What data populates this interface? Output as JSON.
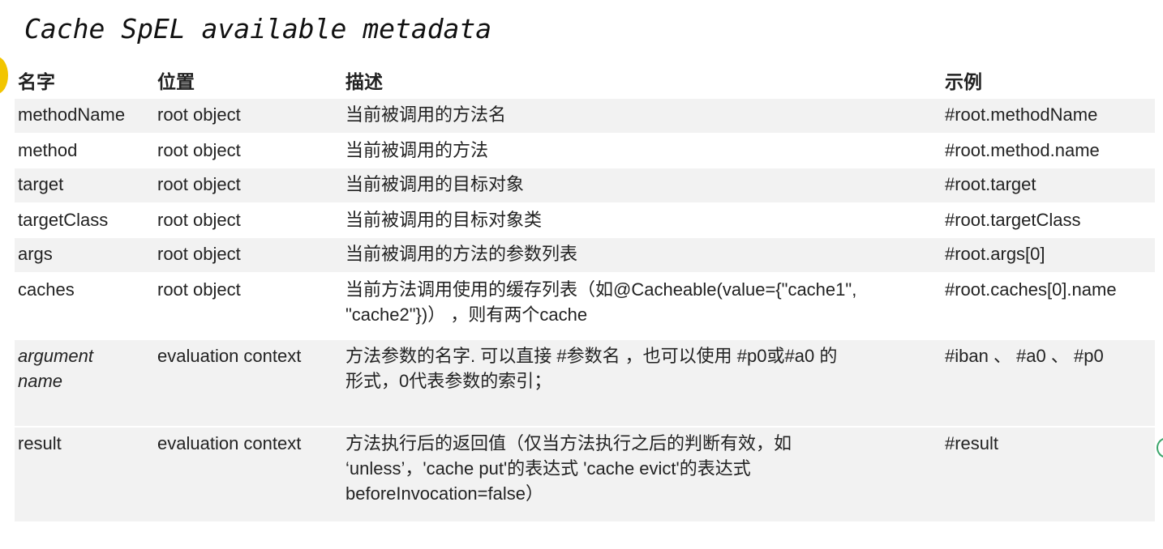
{
  "title": "Cache SpEL available metadata",
  "headers": {
    "name": "名字",
    "location": "位置",
    "description": "描述",
    "example": "示例"
  },
  "rows": [
    {
      "name": "methodName",
      "location": "root object",
      "description": "当前被调用的方法名",
      "example": "#root.methodName"
    },
    {
      "name": "method",
      "location": "root object",
      "description": "当前被调用的方法",
      "example": "#root.method.name"
    },
    {
      "name": "target",
      "location": "root object",
      "description": "当前被调用的目标对象",
      "example": "#root.target"
    },
    {
      "name": "targetClass",
      "location": "root object",
      "description": "当前被调用的目标对象类",
      "example": "#root.targetClass"
    },
    {
      "name": "args",
      "location": "root object",
      "description": "当前被调用的方法的参数列表",
      "example": "#root.args[0]"
    },
    {
      "name": "caches",
      "location": "root object",
      "description_line1": "当前方法调用使用的缓存列表（如@Cacheable(value={\"cache1\",",
      "description_line2": "\"cache2\"})） ，则有两个cache",
      "example": "#root.caches[0].name"
    },
    {
      "name_line1": "argument",
      "name_line2": "name",
      "location": "evaluation context",
      "description_line1": "方法参数的名字. 可以直接 #参数名 ，也可以使用 #p0或#a0 的",
      "description_line2": "形式，0代表参数的索引；",
      "example": "#iban 、 #a0 、  #p0"
    },
    {
      "name": "result",
      "location": "evaluation context",
      "description_line1": "方法执行后的返回值（仅当方法执行之后的判断有效，如",
      "description_line2": "‘unless’，'cache put'的表达式 'cache evict'的表达式",
      "description_line3": "beforeInvocation=false）",
      "example": "#result"
    }
  ]
}
